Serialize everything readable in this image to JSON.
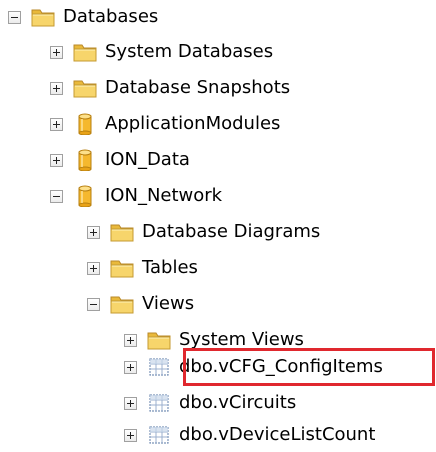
{
  "tree": {
    "root": {
      "label": "Databases",
      "state": "expanded",
      "icon": "folder-icon"
    },
    "system_databases": {
      "label": "System Databases",
      "state": "collapsed",
      "icon": "folder-icon"
    },
    "database_snapshots": {
      "label": "Database Snapshots",
      "state": "collapsed",
      "icon": "folder-icon"
    },
    "application_modules": {
      "label": "ApplicationModules",
      "state": "collapsed",
      "icon": "database-icon"
    },
    "ion_data": {
      "label": "ION_Data",
      "state": "collapsed",
      "icon": "database-icon"
    },
    "ion_network": {
      "label": "ION_Network",
      "state": "expanded",
      "icon": "database-icon"
    },
    "database_diagrams": {
      "label": "Database Diagrams",
      "state": "collapsed",
      "icon": "folder-icon"
    },
    "tables": {
      "label": "Tables",
      "state": "collapsed",
      "icon": "folder-icon"
    },
    "views": {
      "label": "Views",
      "state": "expanded",
      "icon": "folder-icon"
    },
    "system_views": {
      "label": "System Views",
      "state": "collapsed",
      "icon": "folder-icon"
    },
    "view_config_items": {
      "label": "dbo.vCFG_ConfigItems",
      "state": "collapsed",
      "icon": "view-icon",
      "highlighted": true
    },
    "view_circuits": {
      "label": "dbo.vCircuits",
      "state": "collapsed",
      "icon": "view-icon"
    },
    "view_device_list_count": {
      "label": "dbo.vDeviceListCount",
      "state": "collapsed",
      "icon": "view-icon"
    }
  },
  "colors": {
    "folder": "#f2c94c",
    "folder_dark": "#c8962a",
    "database": "#f5b82e",
    "highlight_border": "#e0282e",
    "view_grid": "#7a93b8"
  }
}
